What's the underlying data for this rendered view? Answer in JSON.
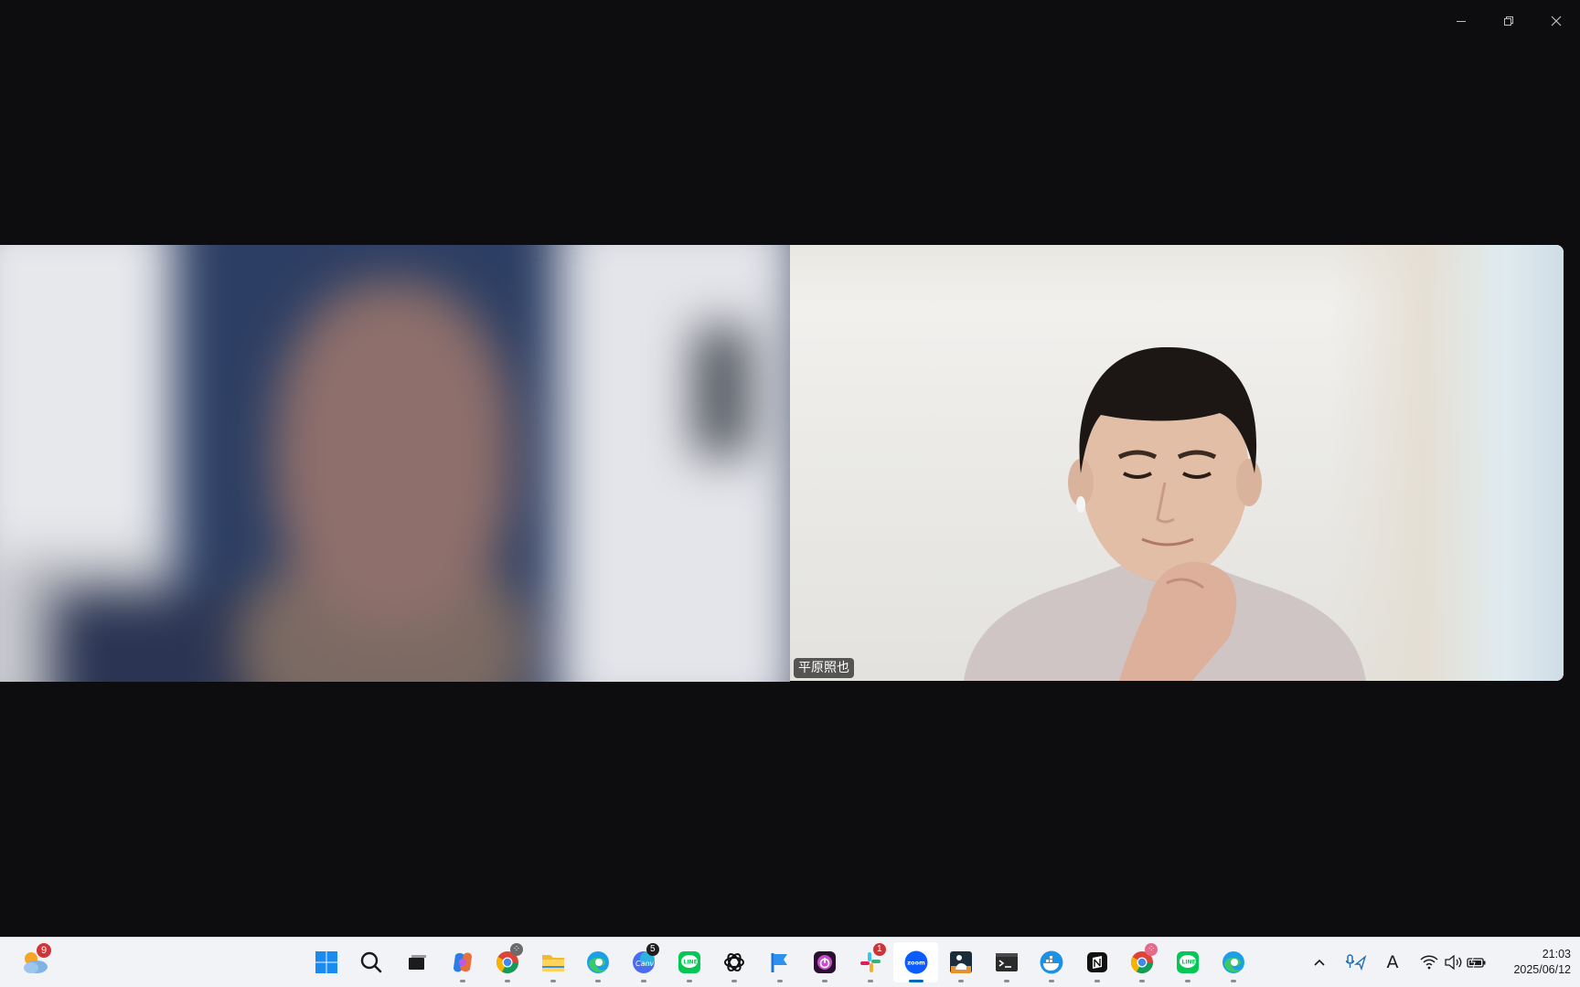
{
  "window": {
    "controls": {
      "minimize": "minimize",
      "restore": "restore",
      "close": "close"
    }
  },
  "participants": [
    {
      "name": "",
      "video": "blurred"
    },
    {
      "name": "平原照也",
      "video": "camera"
    }
  ],
  "taskbar": {
    "weather": {
      "icon": "weather-cloud-sun-icon",
      "badge": "9"
    },
    "apps": [
      {
        "id": "start",
        "icon": "windows-start-icon"
      },
      {
        "id": "search",
        "icon": "search-icon"
      },
      {
        "id": "task-view",
        "icon": "task-view-icon"
      },
      {
        "id": "copilot",
        "icon": "copilot-icon"
      },
      {
        "id": "chrome",
        "icon": "chrome-icon"
      },
      {
        "id": "file-explorer",
        "icon": "folder-icon"
      },
      {
        "id": "edge",
        "icon": "edge-icon"
      },
      {
        "id": "canva",
        "icon": "canva-icon",
        "badge": "5"
      },
      {
        "id": "line",
        "icon": "line-icon"
      },
      {
        "id": "chatgpt",
        "icon": "chatgpt-icon"
      },
      {
        "id": "flag-app",
        "icon": "flag-icon"
      },
      {
        "id": "power-app",
        "icon": "power-icon"
      },
      {
        "id": "slack",
        "icon": "slack-icon",
        "badge": "1"
      },
      {
        "id": "zoom",
        "icon": "zoom-icon",
        "label": "zoom",
        "active": true
      },
      {
        "id": "kindle",
        "icon": "kindle-reader-icon"
      },
      {
        "id": "terminal",
        "icon": "terminal-icon"
      },
      {
        "id": "docker",
        "icon": "docker-icon"
      },
      {
        "id": "notion",
        "icon": "notion-icon"
      },
      {
        "id": "chrome-2",
        "icon": "chrome-profile-icon"
      },
      {
        "id": "line-2",
        "icon": "line-icon"
      },
      {
        "id": "edge-2",
        "icon": "edge-icon"
      }
    ],
    "tray": {
      "overflow_icon": "chevron-up-icon",
      "input_label": "A",
      "time": "21:03",
      "date": "2025/06/12"
    }
  },
  "colors": {
    "background": "#0d0d0f",
    "taskbar": "#f2f3f7",
    "accent": "#0067c0",
    "badge_red": "#d13438"
  }
}
